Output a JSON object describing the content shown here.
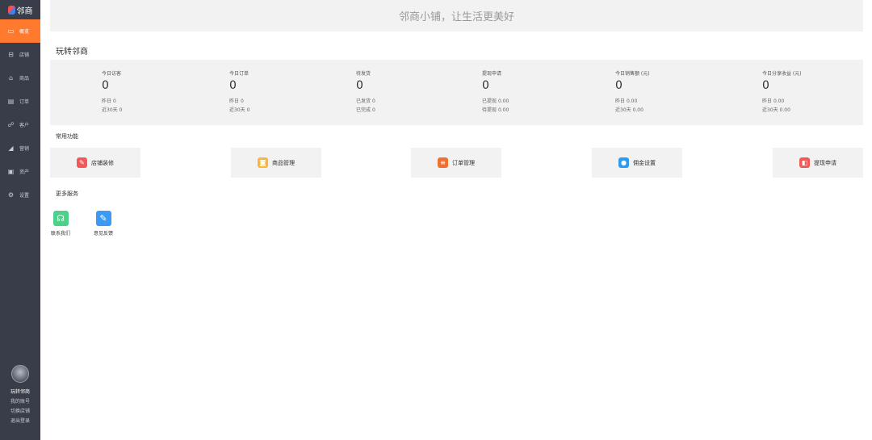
{
  "sidebar": {
    "logo_text": "邻商",
    "items": [
      {
        "icon": "monitor-icon",
        "glyph": "▭",
        "label": "概览",
        "active": true
      },
      {
        "icon": "store-icon",
        "glyph": "⊟",
        "label": "店铺"
      },
      {
        "icon": "product-icon",
        "glyph": "⌂",
        "label": "商品"
      },
      {
        "icon": "order-icon",
        "glyph": "▤",
        "label": "订单"
      },
      {
        "icon": "customer-icon",
        "glyph": "☍",
        "label": "客户"
      },
      {
        "icon": "marketing-icon",
        "glyph": "◢",
        "label": "营销"
      },
      {
        "icon": "asset-icon",
        "glyph": "▣",
        "label": "资产"
      },
      {
        "icon": "settings-icon",
        "glyph": "⚙",
        "label": "设置"
      }
    ],
    "user": {
      "name": "玩转邻商",
      "links": [
        "我的账号",
        "切换店铺",
        "退出登录"
      ]
    }
  },
  "banner": {
    "text": "邻商小铺，让生活更美好"
  },
  "store_title": "玩转邻商",
  "stats": [
    {
      "label": "今日访客",
      "value": "0",
      "sub1_label": "昨日",
      "sub1_value": "0",
      "sub2_label": "近30天",
      "sub2_value": "0"
    },
    {
      "label": "今日订单",
      "value": "0",
      "sub1_label": "昨日",
      "sub1_value": "0",
      "sub2_label": "近30天",
      "sub2_value": "0"
    },
    {
      "label": "待发货",
      "value": "0",
      "sub1_label": "已发货",
      "sub1_value": "0",
      "sub2_label": "已完成",
      "sub2_value": "0"
    },
    {
      "label": "提现申请",
      "value": "0",
      "sub1_label": "已提现",
      "sub1_value": "0.00",
      "sub2_label": "待提现",
      "sub2_value": "0.00"
    },
    {
      "label": "今日销售额 (元)",
      "value": "0",
      "sub1_label": "昨日",
      "sub1_value": "0.00",
      "sub2_label": "近30天",
      "sub2_value": "0.00"
    },
    {
      "label": "今日分享收益 (元)",
      "value": "0",
      "sub1_label": "昨日",
      "sub1_value": "0.00",
      "sub2_label": "近30天",
      "sub2_value": "0.00"
    }
  ],
  "common_title": "常用功能",
  "quick_actions": [
    {
      "label": "店铺装修",
      "icon": "wrench-icon",
      "glyph": "✎",
      "color": "#f25a5a"
    },
    {
      "label": "商品管理",
      "icon": "bag-icon",
      "glyph": "◙",
      "color": "#f6b73c"
    },
    {
      "label": "订单管理",
      "icon": "clipboard-icon",
      "glyph": "≡",
      "color": "#f07030"
    },
    {
      "label": "佣金设置",
      "icon": "coin-icon",
      "glyph": "●",
      "color": "#2d9cf0"
    },
    {
      "label": "提现申请",
      "icon": "wallet-icon",
      "glyph": "◧",
      "color": "#f25a5a"
    }
  ],
  "more_title": "更多服务",
  "services": [
    {
      "label": "联系我们",
      "icon": "headset-icon",
      "glyph": "☊",
      "color": "#4cd08a"
    },
    {
      "label": "意见反馈",
      "icon": "edit-icon",
      "glyph": "✎",
      "color": "#3b9af5"
    }
  ]
}
